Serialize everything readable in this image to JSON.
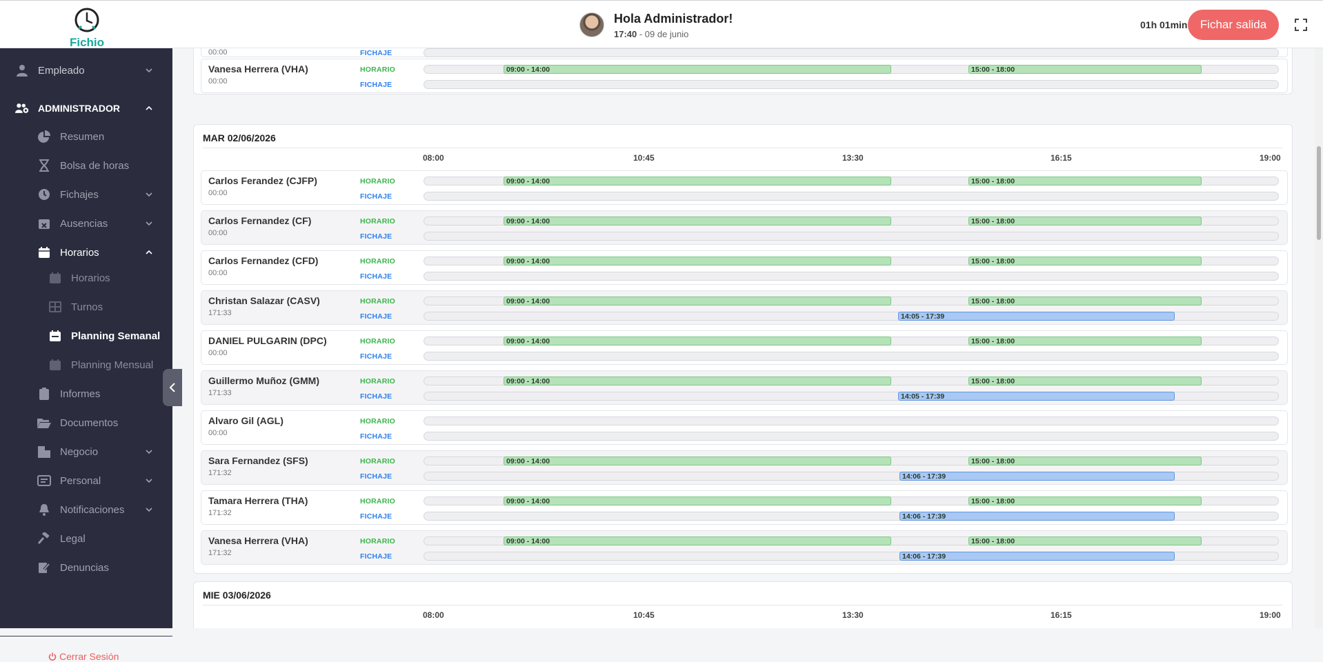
{
  "header": {
    "logo_text": "Fichio",
    "greeting": "Hola Administrador!",
    "time": "17:40",
    "date": " - 09 de junio",
    "elapsed": "01h 01min",
    "fichar_label": "Fichar salida"
  },
  "sidebar": {
    "items": [
      {
        "label": "Empleado"
      },
      {
        "label": "ADMINISTRADOR"
      },
      {
        "label": "Resumen"
      },
      {
        "label": "Bolsa de horas"
      },
      {
        "label": "Fichajes"
      },
      {
        "label": "Ausencias"
      },
      {
        "label": "Horarios"
      },
      {
        "label": "Horarios"
      },
      {
        "label": "Turnos"
      },
      {
        "label": "Planning Semanal"
      },
      {
        "label": "Planning Mensual"
      },
      {
        "label": "Informes"
      },
      {
        "label": "Documentos"
      },
      {
        "label": "Negocio"
      },
      {
        "label": "Personal"
      },
      {
        "label": "Notificaciones"
      },
      {
        "label": "Legal"
      },
      {
        "label": "Denuncias"
      }
    ],
    "logout": "Cerrar Sesión"
  },
  "labels": {
    "horario": "HORARIO",
    "fichaje": "FICHAJE"
  },
  "axis_ticks": [
    "08:00",
    "10:45",
    "13:30",
    "16:15",
    "19:00"
  ],
  "prev_day": {
    "employees": [
      {
        "name": "",
        "time": "00:00"
      },
      {
        "name": "Vanesa Herrera (VHA)",
        "time": "00:00",
        "horario": [
          "09:00 - 14:00",
          "15:00 - 18:00"
        ]
      }
    ]
  },
  "day1": {
    "title": "MAR 02/06/2026",
    "employees": [
      {
        "name": "Carlos Ferandez (CJFP)",
        "time": "00:00",
        "horario": [
          "09:00 - 14:00",
          "15:00 - 18:00"
        ],
        "fichaje": ""
      },
      {
        "name": "Carlos Fernandez (CF)",
        "time": "00:00",
        "horario": [
          "09:00 - 14:00",
          "15:00 - 18:00"
        ],
        "fichaje": ""
      },
      {
        "name": "Carlos Fernandez (CFD)",
        "time": "00:00",
        "horario": [
          "09:00 - 14:00",
          "15:00 - 18:00"
        ],
        "fichaje": ""
      },
      {
        "name": "Christan Salazar (CASV)",
        "time": "171:33",
        "horario": [
          "09:00 - 14:00",
          "15:00 - 18:00"
        ],
        "fichaje": "14:05 - 17:39"
      },
      {
        "name": "DANIEL PULGARIN (DPC)",
        "time": "00:00",
        "horario": [
          "09:00 - 14:00",
          "15:00 - 18:00"
        ],
        "fichaje": ""
      },
      {
        "name": "Guillermo Muñoz (GMM)",
        "time": "171:33",
        "horario": [
          "09:00 - 14:00",
          "15:00 - 18:00"
        ],
        "fichaje": "14:05 - 17:39"
      },
      {
        "name": "Alvaro Gil (AGL)",
        "time": "00:00",
        "horario": [],
        "fichaje": ""
      },
      {
        "name": "Sara Fernandez (SFS)",
        "time": "171:32",
        "horario": [
          "09:00 - 14:00",
          "15:00 - 18:00"
        ],
        "fichaje": "14:06 - 17:39"
      },
      {
        "name": "Tamara Herrera (THA)",
        "time": "171:32",
        "horario": [
          "09:00 - 14:00",
          "15:00 - 18:00"
        ],
        "fichaje": "14:06 - 17:39"
      },
      {
        "name": "Vanesa Herrera (VHA)",
        "time": "171:32",
        "horario": [
          "09:00 - 14:00",
          "15:00 - 18:00"
        ],
        "fichaje": "14:06 - 17:39"
      }
    ]
  },
  "day2": {
    "title": "MIE 03/06/2026"
  },
  "colors": {
    "sidebar_bg": "#2b2d3f",
    "accent": "#1aa89a",
    "fichar": "#f06767",
    "horario_bar": "#b5e2b8",
    "fichaje_bar": "#a9c8f3"
  }
}
